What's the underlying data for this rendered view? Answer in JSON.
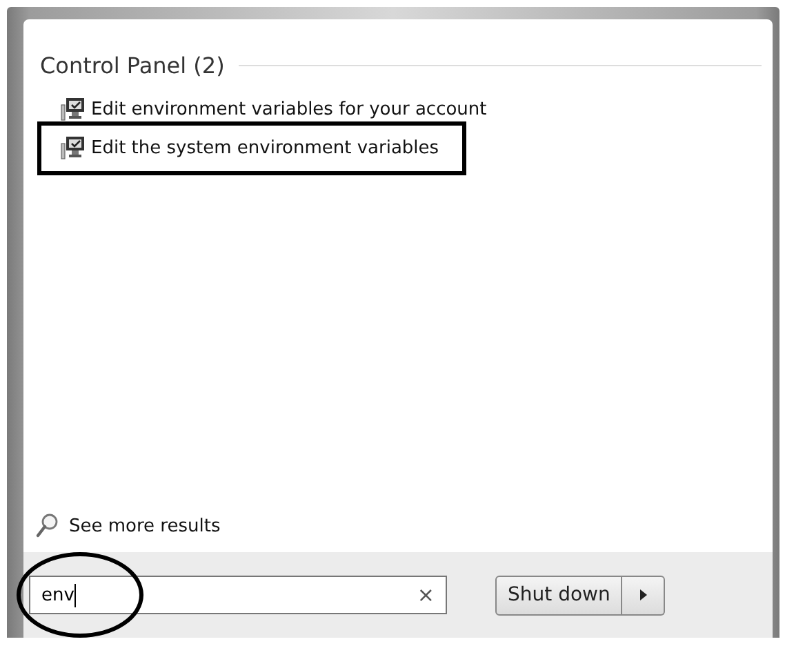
{
  "results": {
    "heading": "Control Panel (2)",
    "items": [
      {
        "label": "Edit environment variables for your account",
        "highlighted": false
      },
      {
        "label": "Edit the system environment variables",
        "highlighted": true
      }
    ]
  },
  "see_more": "See more results",
  "search": {
    "value": "env",
    "clear": "×",
    "circled": true
  },
  "shutdown_button": "Shut down"
}
